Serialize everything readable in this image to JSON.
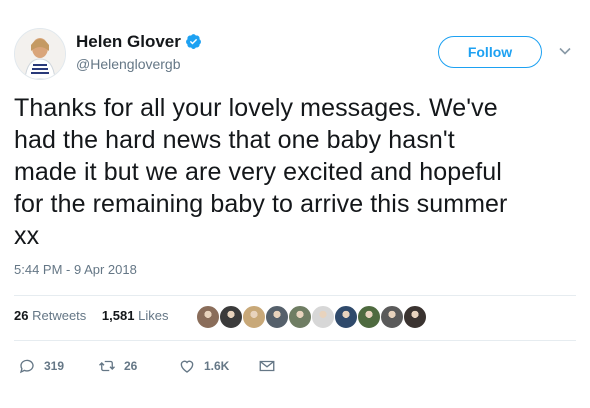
{
  "author": {
    "display_name": "Helen Glover",
    "handle": "@Helenglovergb",
    "verified": true
  },
  "follow_button": {
    "label": "Follow"
  },
  "tweet": {
    "lines": [
      "Thanks for all your lovely messages. We've",
      "had the hard news that one baby hasn't",
      "made it but we are very excited and hopeful",
      "for the remaining baby to arrive this summer",
      "xx"
    ],
    "timestamp": "5:44 PM - 9 Apr 2018"
  },
  "stats": {
    "retweets_count": "26",
    "retweets_label": "Retweets",
    "likes_count": "1,581",
    "likes_label": "Likes"
  },
  "liker_avatars": [
    "#8a6d5a",
    "#3b3b3b",
    "#c8a878",
    "#55606b",
    "#6f7d63",
    "#d7d7d7",
    "#2f4a6b",
    "#4e6a3f",
    "#5a5a5a",
    "#3a3330"
  ],
  "actions": {
    "reply_count": "319",
    "retweet_count": "26",
    "like_count": "1.6K"
  },
  "colors": {
    "accent": "#1da1f2",
    "text": "#14171a",
    "secondary": "#657786",
    "divider": "#e6ecf0"
  }
}
